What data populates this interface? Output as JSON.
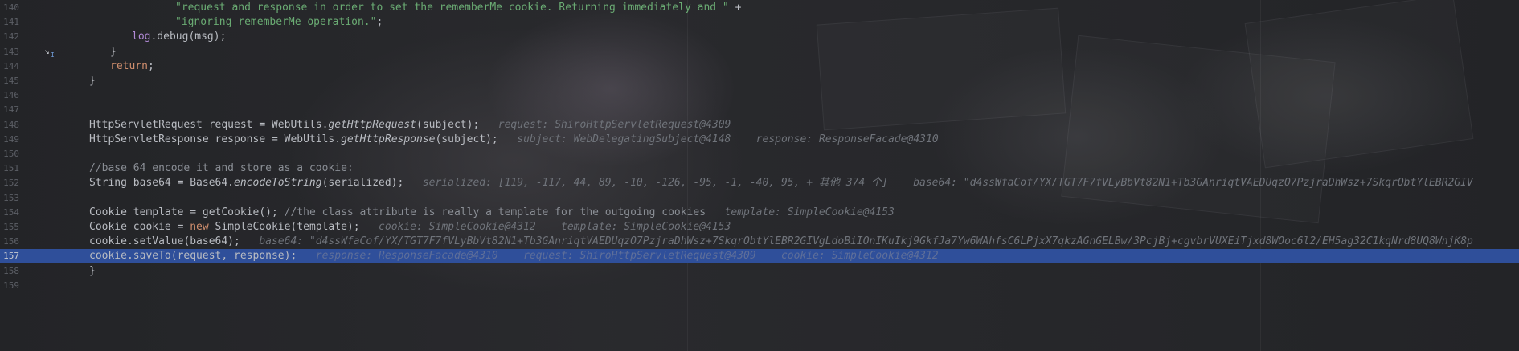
{
  "lines": [
    {
      "num": "140",
      "parts": [
        {
          "t": "\"request and response in order to set the rememberMe cookie. Returning immediately and \"",
          "c": "str"
        },
        {
          "t": " +",
          "c": "plain"
        }
      ]
    },
    {
      "num": "141",
      "parts": [
        {
          "t": "\"ignoring rememberMe operation.\"",
          "c": "str"
        },
        {
          "t": ";",
          "c": "plain"
        }
      ]
    },
    {
      "num": "142",
      "parts": [
        {
          "t": "log",
          "c": "field"
        },
        {
          "t": ".debug(msg);",
          "c": "plain"
        }
      ]
    },
    {
      "num": "143",
      "parts": [
        {
          "t": "}",
          "c": "plain"
        }
      ]
    },
    {
      "num": "144",
      "parts": [
        {
          "t": "return",
          "c": "kw"
        },
        {
          "t": ";",
          "c": "plain"
        }
      ]
    },
    {
      "num": "145",
      "parts": [
        {
          "t": "}",
          "c": "plain"
        }
      ]
    },
    {
      "num": "146",
      "parts": []
    },
    {
      "num": "147",
      "parts": []
    },
    {
      "num": "148",
      "parts": [
        {
          "t": "HttpServletRequest request = WebUtils.",
          "c": "plain"
        },
        {
          "t": "getHttpRequest",
          "c": "fn"
        },
        {
          "t": "(subject);",
          "c": "plain"
        }
      ],
      "hints": [
        "request: ShiroHttpServletRequest@4309"
      ]
    },
    {
      "num": "149",
      "parts": [
        {
          "t": "HttpServletResponse response = WebUtils.",
          "c": "plain"
        },
        {
          "t": "getHttpResponse",
          "c": "fn"
        },
        {
          "t": "(subject);",
          "c": "plain"
        }
      ],
      "hints": [
        "subject: WebDelegatingSubject@4148",
        "response: ResponseFacade@4310"
      ]
    },
    {
      "num": "150",
      "parts": []
    },
    {
      "num": "151",
      "parts": [
        {
          "t": "//base 64 encode it and store as a cookie:",
          "c": "com"
        }
      ]
    },
    {
      "num": "152",
      "parts": [
        {
          "t": "String base64 = Base64.",
          "c": "plain"
        },
        {
          "t": "encodeToString",
          "c": "fn"
        },
        {
          "t": "(serialized);",
          "c": "plain"
        }
      ],
      "hints": [
        "serialized: [119, -117, 44, 89, -10, -126, -95, -1, -40, 95, + 其他 374 个]",
        "base64: \"d4ssWfaCof/YX/TGT7F7fVLyBbVt82N1+Tb3GAnriqtVAEDUqzO7PzjraDhWsz+7SkqrObtYlEBR2GIV"
      ]
    },
    {
      "num": "153",
      "parts": []
    },
    {
      "num": "154",
      "parts": [
        {
          "t": "Cookie template = getCookie(); ",
          "c": "plain"
        },
        {
          "t": "//the class attribute is really a template for the outgoing cookies",
          "c": "com"
        }
      ],
      "hints": [
        "template: SimpleCookie@4153"
      ]
    },
    {
      "num": "155",
      "parts": [
        {
          "t": "Cookie cookie = ",
          "c": "plain"
        },
        {
          "t": "new",
          "c": "kw"
        },
        {
          "t": " SimpleCookie(template);",
          "c": "plain"
        }
      ],
      "hints": [
        "cookie: SimpleCookie@4312",
        "template: SimpleCookie@4153"
      ]
    },
    {
      "num": "156",
      "parts": [
        {
          "t": "cookie.setValue(base64);",
          "c": "plain"
        }
      ],
      "hints": [
        "base64: \"d4ssWfaCof/YX/TGT7F7fVLyBbVt82N1+Tb3GAnriqtVAEDUqzO7PzjraDhWsz+7SkqrObtYlEBR2GIVgLdoBiIOnIKuIkj9GkfJa7Yw6WAhfsC6LPjxX7qkzAGnGELBw/3PcjBj+cgvbrVUXEiTjxd8WOoc6l2/EH5ag32C1kqNrd8UQ8WnjK8p"
      ]
    },
    {
      "num": "157",
      "parts": [
        {
          "t": "cookie.saveTo(request, response);",
          "c": "plain"
        }
      ],
      "hints": [
        "response: ResponseFacade@4310",
        "request: ShiroHttpServletRequest@4309",
        "cookie: SimpleCookie@4312"
      ],
      "current": true
    },
    {
      "num": "158",
      "parts": [
        {
          "t": "}",
          "c": "plain"
        }
      ]
    },
    {
      "num": "159",
      "parts": []
    }
  ],
  "step_marker": {
    "glyph": "↘",
    "sub": "I"
  }
}
